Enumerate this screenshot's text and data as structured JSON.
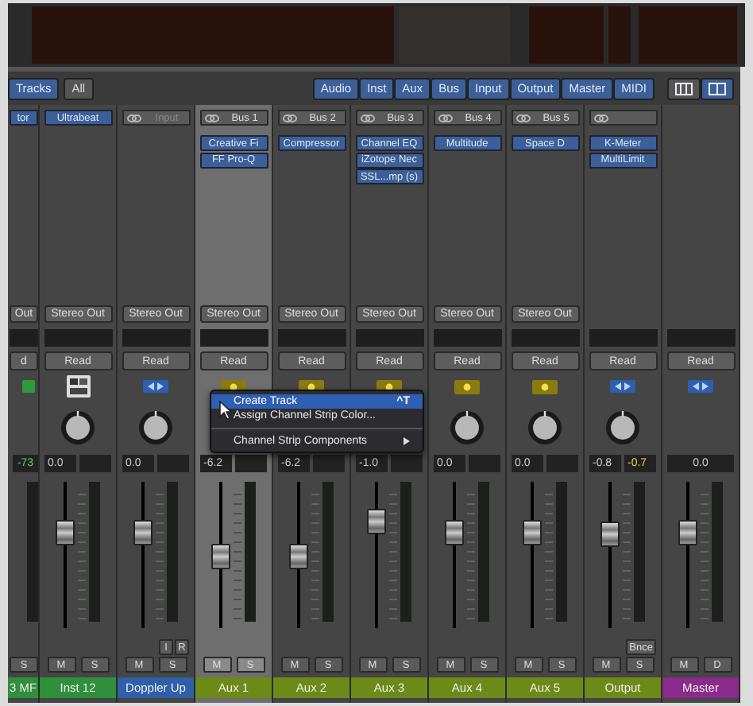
{
  "toolbar": {
    "left": [
      {
        "label": "Tracks",
        "on": true
      },
      {
        "label": "All",
        "on": false
      }
    ],
    "filters": [
      {
        "label": "Audio",
        "on": true
      },
      {
        "label": "Inst",
        "on": true
      },
      {
        "label": "Aux",
        "on": true
      },
      {
        "label": "Bus",
        "on": true
      },
      {
        "label": "Input",
        "on": true
      },
      {
        "label": "Output",
        "on": true
      },
      {
        "label": "Master",
        "on": true
      },
      {
        "label": "MIDI",
        "on": true
      }
    ],
    "views": [
      {
        "selected": false
      },
      {
        "selected": true
      }
    ]
  },
  "strips": [
    {
      "name": "3 MF",
      "color": "#2f8f3a",
      "selected": false,
      "io": {
        "kind": "plugin",
        "label": "tor"
      },
      "output": "Out",
      "automation": "d",
      "kind": "midi",
      "volume": "-73",
      "volume_signal": true,
      "peak_box": false,
      "buttons": [
        "S"
      ]
    },
    {
      "name": "Inst 12",
      "color": "#2f8f3a",
      "selected": false,
      "io": {
        "kind": "plugin",
        "label": "Ultrabeat"
      },
      "output": "Stereo Out",
      "automation": "Read",
      "kind": "instrument",
      "knob": true,
      "volume": "0.0",
      "volume_signal": false,
      "peak_box": true,
      "level": 0.67,
      "buttons": [
        "M",
        "S"
      ]
    },
    {
      "name": "Doppler Up",
      "color": "#2f5fa8",
      "selected": false,
      "io": {
        "kind": "input",
        "label": "Input"
      },
      "output": "Stereo Out",
      "automation": "Read",
      "kind": "audio",
      "knob": true,
      "volume": "0.0",
      "volume_signal": false,
      "peak_box": true,
      "level": 0.67,
      "extra": [
        "I",
        "R"
      ],
      "buttons": [
        "M",
        "S"
      ]
    },
    {
      "name": "Aux 1",
      "color": "#6d8a18",
      "selected": true,
      "io": {
        "kind": "bus",
        "label": "Bus 1"
      },
      "inserts": [
        "Creative Fi",
        "FF Pro-Q"
      ],
      "output": "Stereo Out",
      "automation": "Read",
      "kind": "group",
      "volume": "-6.2",
      "volume_signal": false,
      "peak_box": true,
      "level": 0.47,
      "buttons": [
        "M",
        "S"
      ]
    },
    {
      "name": "Aux 2",
      "color": "#6d8a18",
      "selected": false,
      "io": {
        "kind": "bus",
        "label": "Bus 2"
      },
      "inserts": [
        "Compressor"
      ],
      "output": "Stereo Out",
      "automation": "Read",
      "kind": "group",
      "volume": "-6.2",
      "volume_signal": false,
      "peak_box": true,
      "level": 0.47,
      "buttons": [
        "M",
        "S"
      ]
    },
    {
      "name": "Aux 3",
      "color": "#6d8a18",
      "selected": false,
      "io": {
        "kind": "bus",
        "label": "Bus 3"
      },
      "inserts": [
        "Channel EQ",
        "iZotope Nec",
        "SSL...mp (s)"
      ],
      "output": "Stereo Out",
      "automation": "Read",
      "kind": "group",
      "volume": "-1.0",
      "volume_signal": false,
      "peak_box": true,
      "level": 0.76,
      "buttons": [
        "M",
        "S"
      ]
    },
    {
      "name": "Aux 4",
      "color": "#6d8a18",
      "selected": false,
      "io": {
        "kind": "bus",
        "label": "Bus 4"
      },
      "inserts": [
        "Multitude"
      ],
      "output": "Stereo Out",
      "automation": "Read",
      "kind": "group",
      "knob": true,
      "volume": "0.0",
      "volume_signal": false,
      "peak_box": true,
      "level": 0.67,
      "buttons": [
        "M",
        "S"
      ]
    },
    {
      "name": "Aux 5",
      "color": "#6d8a18",
      "selected": false,
      "io": {
        "kind": "bus",
        "label": "Bus 5"
      },
      "inserts": [
        "Space D"
      ],
      "output": "Stereo Out",
      "automation": "Read",
      "kind": "group",
      "knob": true,
      "volume": "0.0",
      "volume_signal": false,
      "peak_box": true,
      "level": 0.67,
      "buttons": [
        "M",
        "S"
      ]
    },
    {
      "name": "Output",
      "color": "#6d8a18",
      "selected": false,
      "io": {
        "kind": "link"
      },
      "inserts": [
        "K-Meter",
        "MultiLimit"
      ],
      "automation": "Read",
      "kind": "output",
      "knob": true,
      "volume": "-0.8",
      "volume_signal": false,
      "peak_box": true,
      "peak": "-0.7",
      "peak_warning": true,
      "level": 0.65,
      "extra": [
        "Bnce"
      ],
      "buttons": [
        "M",
        "S"
      ]
    },
    {
      "name": "Master",
      "color": "#8a2a8a",
      "selected": false,
      "automation": "Read",
      "kind": "master",
      "volume": "0.0",
      "volume_signal": false,
      "peak_box": false,
      "level": 0.67,
      "buttons": [
        "M",
        "D"
      ]
    }
  ],
  "menu": {
    "items": [
      {
        "label": "Create Track",
        "shortcut": "^T",
        "selected": true
      },
      {
        "label": "Assign Channel Strip Color...",
        "selected": false
      },
      {
        "kind": "separator"
      },
      {
        "label": "Channel Strip Components",
        "submenu": true,
        "selected": false
      }
    ]
  }
}
